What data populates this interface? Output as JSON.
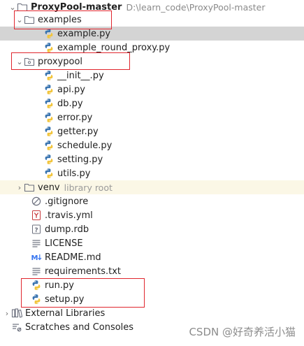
{
  "project": {
    "name": "ProxyPool-master",
    "path": "D:\\learn_code\\ProxyPool-master"
  },
  "folders": {
    "examples": "examples",
    "proxypool": "proxypool",
    "venv": "venv",
    "venv_hint": "library root"
  },
  "examples_files": [
    "example.py",
    "example_round_proxy.py"
  ],
  "proxypool_files": [
    "__init__.py",
    "api.py",
    "db.py",
    "error.py",
    "getter.py",
    "schedule.py",
    "setting.py",
    "utils.py"
  ],
  "root_files": {
    "gitignore": ".gitignore",
    "travis": ".travis.yml",
    "dump": "dump.rdb",
    "license": "LICENSE",
    "readme": "README.md",
    "requirements": "requirements.txt",
    "run": "run.py",
    "setup": "setup.py"
  },
  "bottom": {
    "external": "External Libraries",
    "scratches": "Scratches and Consoles"
  },
  "icons": {
    "folder": "folder-icon",
    "package": "package-icon",
    "python": "python-file-icon",
    "ignore": "gitignore-icon",
    "yaml": "yaml-icon",
    "unknown": "unknown-file-icon",
    "text": "text-file-icon",
    "markdown": "markdown-icon",
    "libraries": "libraries-icon",
    "scratches": "scratches-icon"
  },
  "colors": {
    "highlight_box": "#e0262e",
    "selected_row": "#d4d4d4",
    "library_root_row": "#fbf7e6"
  },
  "watermark": "CSDN @好奇养活小猫"
}
